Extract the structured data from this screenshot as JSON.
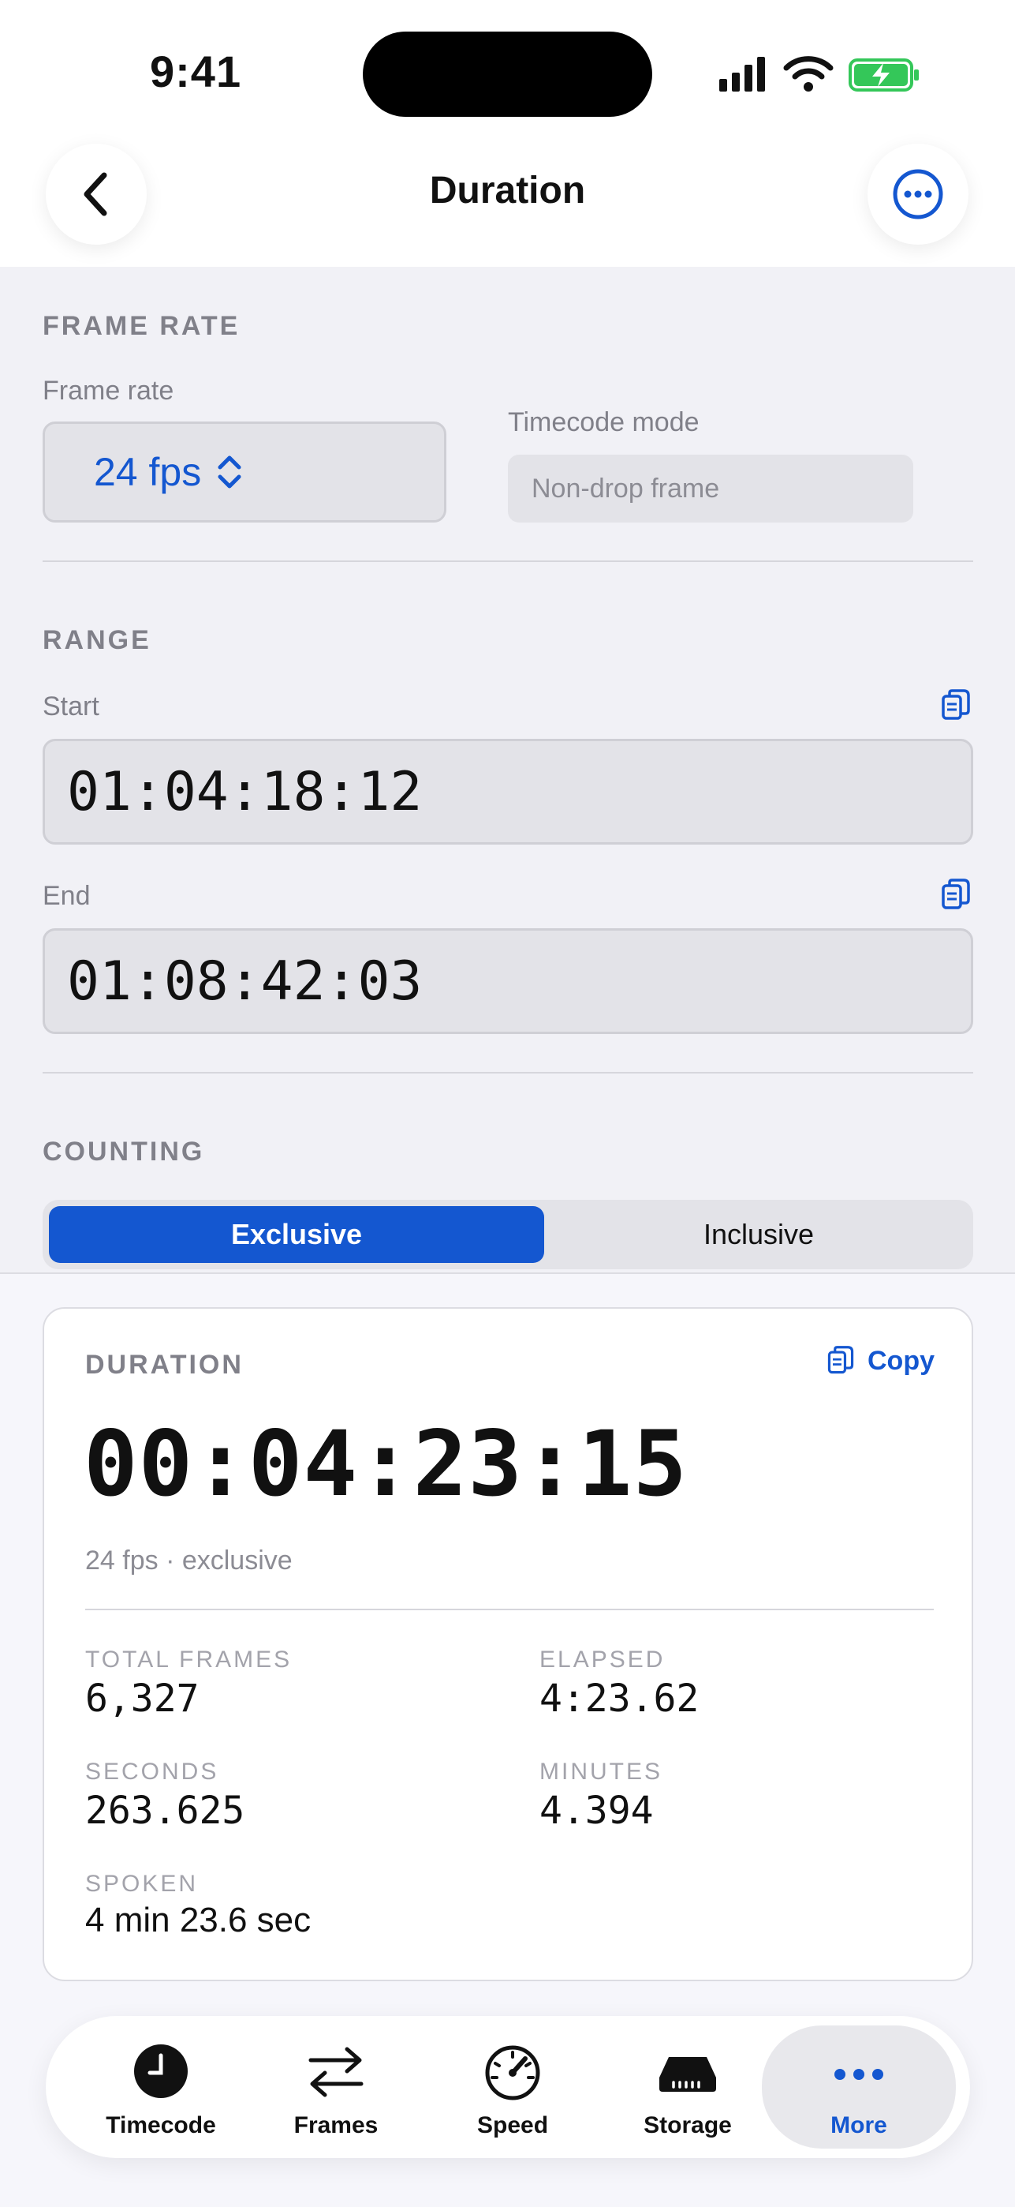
{
  "status_bar": {
    "time": "9:41"
  },
  "header": {
    "title": "Duration",
    "back_icon": "chevron-left-icon",
    "more_icon": "ellipsis-circle-icon"
  },
  "frame_rate": {
    "section_label": "FRAME RATE",
    "field_label": "Frame rate",
    "selected": "24 fps",
    "timecode_mode_label": "Timecode mode",
    "timecode_mode_placeholder": "Non-drop frame"
  },
  "range": {
    "section_label": "RANGE",
    "start_label": "Start",
    "start_value": "01:04:18:12",
    "end_label": "End",
    "end_value": "01:08:42:03"
  },
  "counting": {
    "section_label": "COUNTING",
    "options": [
      "Exclusive",
      "Inclusive"
    ],
    "selected": "Exclusive"
  },
  "result": {
    "label": "DURATION",
    "copy_label": "Copy",
    "timecode": "00:04:23:15",
    "subtitle": "24 fps · exclusive",
    "stats": {
      "total_frames_label": "TOTAL FRAMES",
      "total_frames": "6,327",
      "elapsed_label": "ELAPSED",
      "elapsed": "4:23.62",
      "seconds_label": "SECONDS",
      "seconds": "263.625",
      "minutes_label": "MINUTES",
      "minutes": "4.394",
      "spoken_label": "SPOKEN",
      "spoken": "4 min 23.6 sec"
    }
  },
  "tabbar": {
    "items": [
      {
        "label": "Timecode",
        "icon": "clock-icon"
      },
      {
        "label": "Frames",
        "icon": "arrows-left-right-icon"
      },
      {
        "label": "Speed",
        "icon": "speedometer-icon"
      },
      {
        "label": "Storage",
        "icon": "drive-icon"
      },
      {
        "label": "More",
        "icon": "ellipsis-icon"
      }
    ],
    "active": "More"
  },
  "colors": {
    "accent": "#1457d0",
    "background": "#f1f1f6",
    "battery": "#34c759"
  }
}
